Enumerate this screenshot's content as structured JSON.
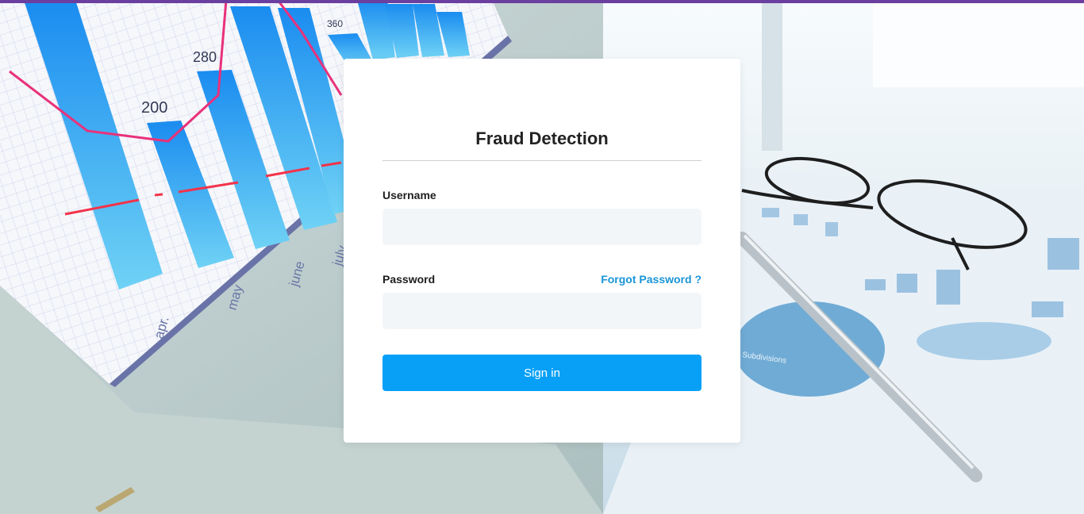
{
  "login": {
    "title": "Fraud Detection",
    "username_label": "Username",
    "username_value": "",
    "password_label": "Password",
    "password_value": "",
    "forgot_password": "Forgot Password ?",
    "signin_label": "Sign in"
  },
  "background": {
    "bar_labels": [
      "200",
      "280",
      "360"
    ],
    "month_labels": [
      "apr.",
      "may",
      "june",
      "july"
    ],
    "pie_caption": "Subdivisions"
  },
  "colors": {
    "accent": "#08a0f7",
    "link": "#1b95d6",
    "top_strip": "#6b3fa0",
    "input_bg": "#f3f6f9"
  }
}
